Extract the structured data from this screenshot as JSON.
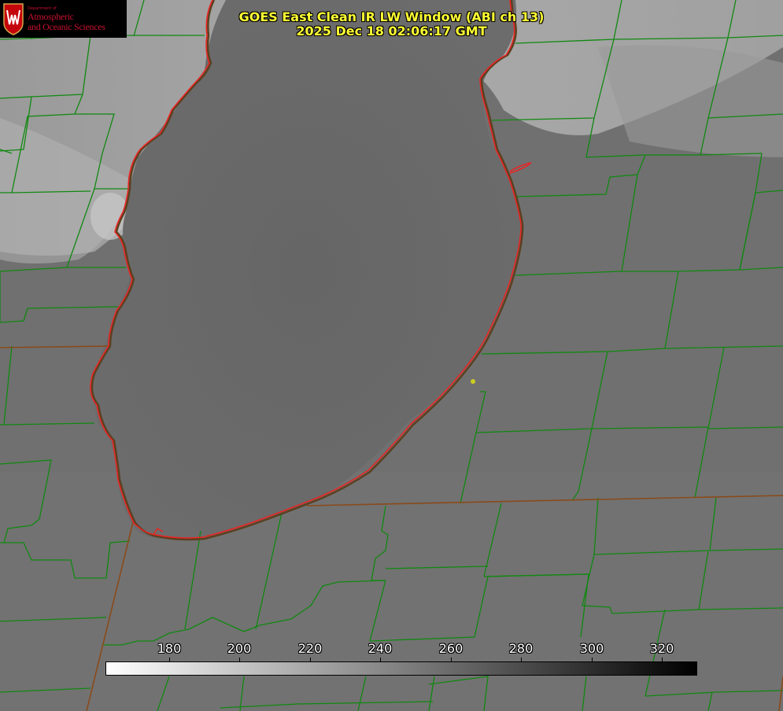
{
  "header": {
    "title_line1": "GOES East Clean IR LW Window (ABI ch 13)",
    "title_line2": "2025 Dec 18 02:06:17 GMT"
  },
  "logo": {
    "department": "Department of",
    "line1": "Atmospheric",
    "line2": "and Oceanic Sciences",
    "icon": "uw-crest-icon"
  },
  "colorbar": {
    "ticks": [
      "180",
      "200",
      "220",
      "240",
      "260",
      "280",
      "300",
      "320"
    ]
  },
  "colors": {
    "background": "#6f6f6f",
    "county_lines": "#118811",
    "state_lines": "#8a4a1a",
    "shoreline": "#ee2222",
    "title_text": "#ffff33",
    "marker": "#cccc22"
  }
}
